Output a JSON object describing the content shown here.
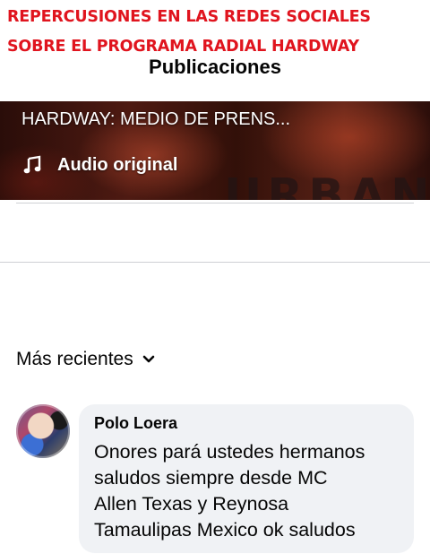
{
  "banner": {
    "line1": "REPERCUSIONES EN LAS REDES SOCIALES",
    "line2": "SOBRE EL PROGRAMA RADIAL HARDWAY",
    "color": "#e0141e"
  },
  "page": {
    "title": "Publicaciones"
  },
  "video": {
    "title": "HARDWAY: MEDIO DE PRENS...",
    "audio_label": "Audio original",
    "audio_icon": "music-note-icon",
    "watermark": "URBAND"
  },
  "sort": {
    "label": "Más recientes",
    "icon": "chevron-down-icon"
  },
  "comments": [
    {
      "author": "Polo Loera",
      "text_lines": [
        "Onores pará ustedes hermanos",
        "saludos siempre desde MC",
        "Allen Texas y Reynosa",
        "Tamaulipas Mexico ok saludos"
      ],
      "bubble_color": "#f0f2f5"
    }
  ]
}
